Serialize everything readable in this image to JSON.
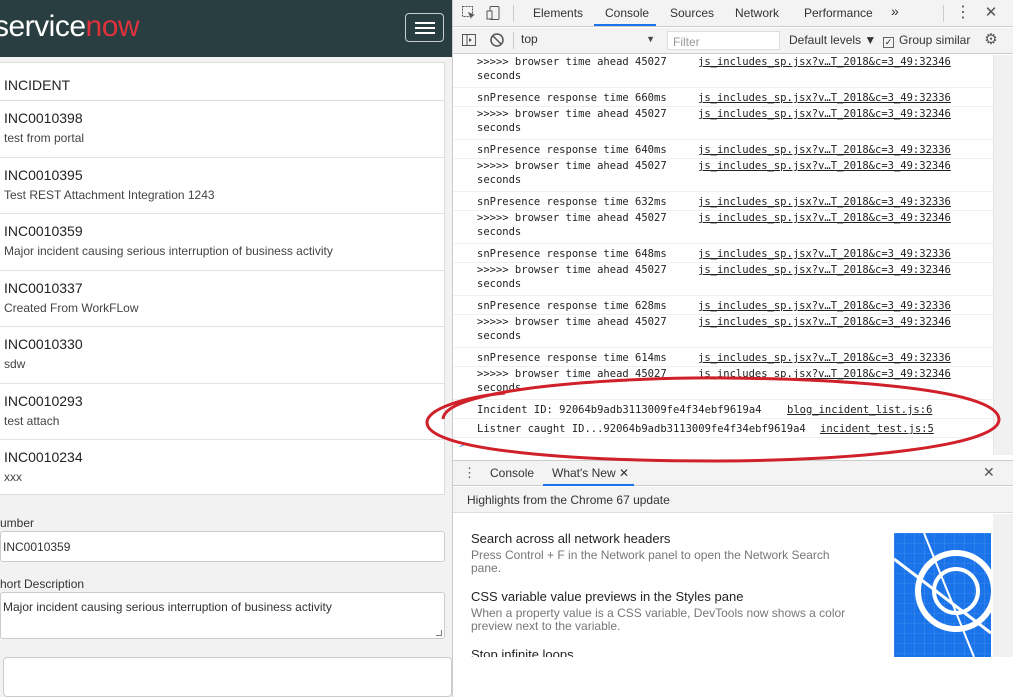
{
  "portal": {
    "logo_service": "service",
    "logo_now": "now",
    "brand_color": "#293e40",
    "accent_color": "#e0323c",
    "menu_icon": "hamburger-icon",
    "incident_heading": "INCIDENT",
    "incidents": [
      {
        "number": "INC0010398",
        "description": "test from portal"
      },
      {
        "number": "INC0010395",
        "description": "Test REST Attachment Integration 1243"
      },
      {
        "number": "INC0010359",
        "description": "Major incident causing serious interruption of business activity"
      },
      {
        "number": "INC0010337",
        "description": "Created From WorkFLow"
      },
      {
        "number": "INC0010330",
        "description": "sdw"
      },
      {
        "number": "INC0010293",
        "description": "test attach"
      },
      {
        "number": "INC0010234",
        "description": "xxx"
      }
    ],
    "number_label": "umber",
    "number_value": "INC0010359",
    "short_desc_label": "hort Description",
    "short_desc_value": "Major incident causing serious interruption of business activity"
  },
  "devtools": {
    "tabs": [
      "Elements",
      "Console",
      "Sources",
      "Network",
      "Performance"
    ],
    "active_tab": "Console",
    "more_tabs": "»",
    "context": "top",
    "filter_placeholder": "Filter",
    "levels": "Default levels ▼",
    "group_similar": "Group similar",
    "group_similar_checked": "✓",
    "log": [
      {
        "msg": ">>>>> browser time ahead 45027\nseconds",
        "src": "js_includes_sp.jsx?v…T_2018&c=3_49:32346"
      },
      {
        "msg": "snPresence response time 660ms",
        "src": "js_includes_sp.jsx?v…T_2018&c=3_49:32336"
      },
      {
        "msg": ">>>>> browser time ahead 45027\nseconds",
        "src": "js_includes_sp.jsx?v…T_2018&c=3_49:32346"
      },
      {
        "msg": "snPresence response time 640ms",
        "src": "js_includes_sp.jsx?v…T_2018&c=3_49:32336"
      },
      {
        "msg": ">>>>> browser time ahead 45027\nseconds",
        "src": "js_includes_sp.jsx?v…T_2018&c=3_49:32346"
      },
      {
        "msg": "snPresence response time 632ms",
        "src": "js_includes_sp.jsx?v…T_2018&c=3_49:32336"
      },
      {
        "msg": ">>>>> browser time ahead 45027\nseconds",
        "src": "js_includes_sp.jsx?v…T_2018&c=3_49:32346"
      },
      {
        "msg": "snPresence response time 648ms",
        "src": "js_includes_sp.jsx?v…T_2018&c=3_49:32336"
      },
      {
        "msg": ">>>>> browser time ahead 45027\nseconds",
        "src": "js_includes_sp.jsx?v…T_2018&c=3_49:32346"
      },
      {
        "msg": "snPresence response time 628ms",
        "src": "js_includes_sp.jsx?v…T_2018&c=3_49:32336"
      },
      {
        "msg": ">>>>> browser time ahead 45027\nseconds",
        "src": "js_includes_sp.jsx?v…T_2018&c=3_49:32346"
      },
      {
        "msg": "snPresence response time 614ms",
        "src": "js_includes_sp.jsx?v…T_2018&c=3_49:32336"
      },
      {
        "msg": ">>>>> browser time ahead 45027\nseconds",
        "src": "js_includes_sp.jsx?v…T_2018&c=3_49:32346"
      }
    ],
    "highlighted_log": [
      {
        "msg": "Incident ID: 92064b9adb3113009fe4f34ebf9619a4",
        "src": "blog_incident_list.js:6"
      },
      {
        "msg": "Listner caught ID...92064b9adb3113009fe4f34ebf9619a4",
        "src": "incident_test.js:5"
      }
    ],
    "prompt": ">",
    "drawer_tabs": [
      "Console",
      "What's New"
    ],
    "drawer_active": "What's New",
    "highlights": "Highlights from the Chrome 67 update",
    "whats_new": [
      {
        "title": "Search across all network headers",
        "body": "Press Control + F in the Network panel to open the Network Search pane."
      },
      {
        "title": "CSS variable value previews in the Styles pane",
        "body": "When a property value is a CSS variable, DevTools now shows a color preview next to the variable."
      },
      {
        "title": "Stop infinite loops",
        "body": ""
      }
    ],
    "accent_color": "#1a73e8",
    "annotation_color": "#d0202a"
  }
}
